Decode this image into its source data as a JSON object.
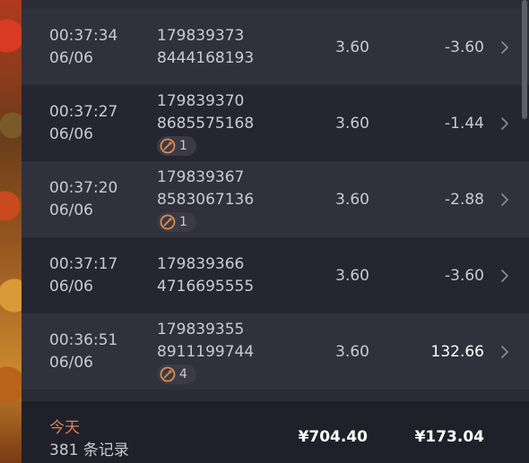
{
  "rows": [
    {
      "time": "00:37:34",
      "date": "06/06",
      "id_line1": "179839373",
      "id_line2": "8444168193",
      "bet": "3.60",
      "win": "-3.60",
      "badge": null
    },
    {
      "time": "00:37:27",
      "date": "06/06",
      "id_line1": "179839370",
      "id_line2": "8685575168",
      "bet": "3.60",
      "win": "-1.44",
      "badge": "1"
    },
    {
      "time": "00:37:20",
      "date": "06/06",
      "id_line1": "179839367",
      "id_line2": "8583067136",
      "bet": "3.60",
      "win": "-2.88",
      "badge": "1"
    },
    {
      "time": "00:37:17",
      "date": "06/06",
      "id_line1": "179839366",
      "id_line2": "4716695555",
      "bet": "3.60",
      "win": "-3.60",
      "badge": null
    },
    {
      "time": "00:36:51",
      "date": "06/06",
      "id_line1": "179839355",
      "id_line2": "8911199744",
      "bet": "3.60",
      "win": "132.66",
      "badge": "4"
    }
  ],
  "footer": {
    "day_label": "今天",
    "records_label": "381 条记录",
    "total_bet": "¥704.40",
    "total_win": "¥173.04"
  },
  "icons": {
    "row_chevron": "chevron-right-icon",
    "badge_icon": "bonus-icon"
  },
  "colors": {
    "day_label": "#d9835a",
    "positive_win": "#ffffff",
    "text": "#c9cad2",
    "badge_icon": "#e08a4e"
  }
}
